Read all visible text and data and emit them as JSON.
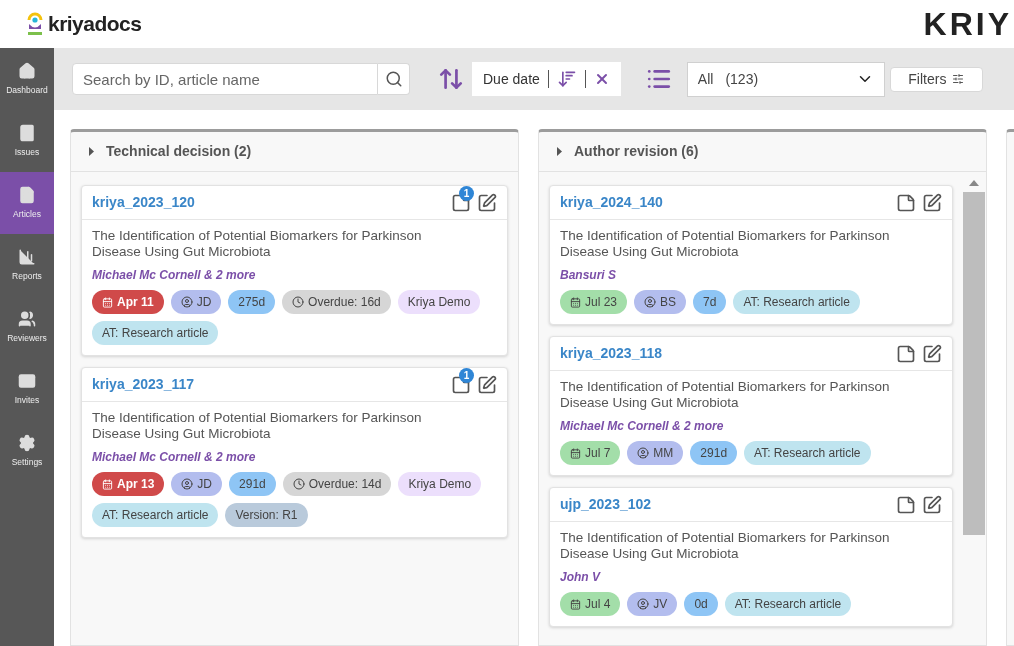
{
  "header": {
    "logo": "kriyadocs",
    "brand": "KRIY"
  },
  "sidebar": {
    "items": [
      {
        "label": "Dashboard",
        "selected": false
      },
      {
        "label": "Issues",
        "selected": false
      },
      {
        "label": "Articles",
        "selected": true
      },
      {
        "label": "Reports",
        "selected": false
      },
      {
        "label": "Reviewers",
        "selected": false
      },
      {
        "label": "Invites",
        "selected": false
      },
      {
        "label": "Settings",
        "selected": false
      }
    ]
  },
  "toolbar": {
    "search": {
      "placeholder": "Search by ID, article name"
    },
    "sort": {
      "label": "Due date"
    },
    "view_select": {
      "value": "All",
      "count": "(123)"
    },
    "filters_button": "Filters"
  },
  "columns": [
    {
      "title": "Technical decision (2)",
      "scrollable": false,
      "cards": [
        {
          "id": "kriya_2023_120",
          "notes": "1",
          "title": "The Identification of Potential Biomarkers for Parkinson Disease Using Gut Microbiota",
          "authors": "Michael Mc Cornell & 2 more",
          "tags": [
            {
              "kind": "date",
              "text": "Apr 11",
              "color": "#d04a4a"
            },
            {
              "kind": "user",
              "text": "JD"
            },
            {
              "kind": "age",
              "text": "275d"
            },
            {
              "kind": "overdue",
              "text": "Overdue: 16d"
            },
            {
              "kind": "customer",
              "text": "Kriya Demo"
            },
            {
              "kind": "type",
              "text": "AT: Research article"
            }
          ]
        },
        {
          "id": "kriya_2023_117",
          "notes": "1",
          "title": "The Identification of Potential Biomarkers for Parkinson Disease Using Gut Microbiota",
          "authors": "Michael Mc Cornell & 2 more",
          "tags": [
            {
              "kind": "date",
              "text": "Apr 13",
              "color": "#d04a4a"
            },
            {
              "kind": "user",
              "text": "JD"
            },
            {
              "kind": "age",
              "text": "291d"
            },
            {
              "kind": "overdue",
              "text": "Overdue: 14d"
            },
            {
              "kind": "customer",
              "text": "Kriya Demo"
            },
            {
              "kind": "type",
              "text": "AT: Research article"
            },
            {
              "kind": "version",
              "text": "Version: R1"
            }
          ]
        }
      ]
    },
    {
      "title": "Author revision (6)",
      "scrollable": true,
      "cards": [
        {
          "id": "kriya_2024_140",
          "title": "The Identification of Potential Biomarkers for Parkinson Disease Using Gut Microbiota",
          "authors": "Bansuri S",
          "tags": [
            {
              "kind": "date",
              "text": "Jul 23",
              "color": "#a3dea9"
            },
            {
              "kind": "user",
              "text": "BS"
            },
            {
              "kind": "age",
              "text": "7d"
            },
            {
              "kind": "type",
              "text": "AT: Research article"
            }
          ]
        },
        {
          "id": "kriya_2023_118",
          "title": "The Identification of Potential Biomarkers for Parkinson Disease Using Gut Microbiota",
          "authors": "Michael Mc Cornell & 2 more",
          "tags": [
            {
              "kind": "date",
              "text": "Jul 7",
              "color": "#a3dea9"
            },
            {
              "kind": "user",
              "text": "MM"
            },
            {
              "kind": "age",
              "text": "291d"
            },
            {
              "kind": "type",
              "text": "AT: Research article"
            }
          ]
        },
        {
          "id": "ujp_2023_102",
          "title": "The Identification of Potential Biomarkers for Parkinson Disease Using Gut Microbiota",
          "authors": "John V",
          "tags": [
            {
              "kind": "date",
              "text": "Jul 4",
              "color": "#a3dea9"
            },
            {
              "kind": "user",
              "text": "JV"
            },
            {
              "kind": "age",
              "text": "0d"
            },
            {
              "kind": "type",
              "text": "AT: Research article"
            }
          ]
        }
      ]
    }
  ]
}
